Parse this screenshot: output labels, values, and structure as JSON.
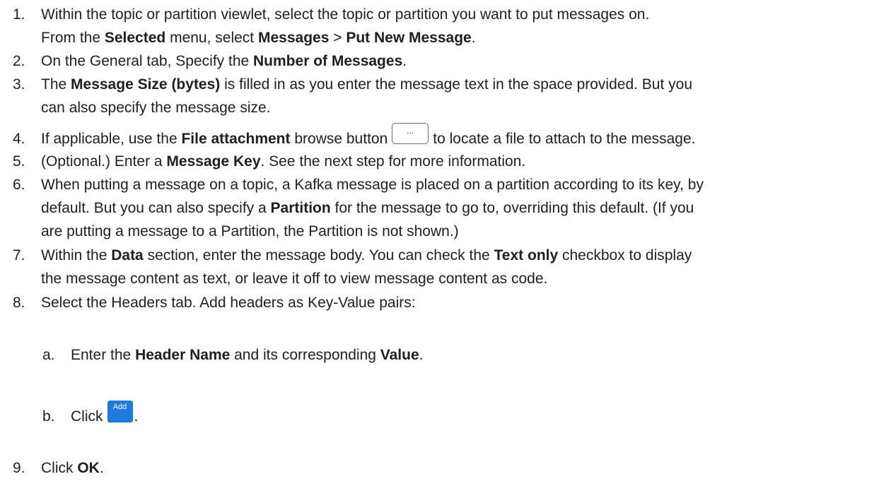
{
  "steps": [
    {
      "num": "1.",
      "lines": [
        [
          {
            "t": "Within the topic or partition viewlet, select the topic or partition you want to put messages on."
          }
        ],
        [
          {
            "t": "From the "
          },
          {
            "t": "Selected",
            "b": true
          },
          {
            "t": " menu, select "
          },
          {
            "t": "Messages",
            "b": true
          },
          {
            "t": " > "
          },
          {
            "t": "Put New Message",
            "b": true
          },
          {
            "t": "."
          }
        ]
      ]
    },
    {
      "num": "2.",
      "lines": [
        [
          {
            "t": "On the General tab, Specify the "
          },
          {
            "t": "Number of Messages",
            "b": true
          },
          {
            "t": "."
          }
        ]
      ]
    },
    {
      "num": "3.",
      "lines": [
        [
          {
            "t": "The "
          },
          {
            "t": "Message Size (bytes)",
            "b": true
          },
          {
            "t": " is filled in as you enter the message text in the space provided. But you"
          }
        ],
        [
          {
            "t": "can also specify the message size."
          }
        ]
      ]
    },
    {
      "num": "4.",
      "lines": [
        [
          {
            "t": "If applicable, use the "
          },
          {
            "t": "File attachment",
            "b": true
          },
          {
            "t": " browse button"
          },
          {
            "icon": "browse"
          },
          {
            "t": "to locate a file to attach to the message."
          }
        ]
      ]
    },
    {
      "num": "5.",
      "lines": [
        [
          {
            "t": "(Optional.) Enter a "
          },
          {
            "t": "Message Key",
            "b": true
          },
          {
            "t": ". See the next step for more information."
          }
        ]
      ]
    },
    {
      "num": "6.",
      "lines": [
        [
          {
            "t": "When putting a message on a topic, a Kafka message is placed on a partition according to its key, by"
          }
        ],
        [
          {
            "t": "default. But you can also specify a "
          },
          {
            "t": "Partition",
            "b": true
          },
          {
            "t": " for the message to go to, overriding this default. (If you"
          }
        ],
        [
          {
            "t": "are putting a message to a Partition, the Partition is not shown.)"
          }
        ]
      ]
    },
    {
      "num": "7.",
      "lines": [
        [
          {
            "t": "Within the "
          },
          {
            "t": "Data",
            "b": true
          },
          {
            "t": " section, enter the message body. You can check the "
          },
          {
            "t": "Text only",
            "b": true
          },
          {
            "t": " checkbox to display"
          }
        ],
        [
          {
            "t": "the message content as text, or leave it off to view message content as code."
          }
        ]
      ]
    },
    {
      "num": "8.",
      "lines": [
        [
          {
            "t": "Select the Headers tab. Add headers as Key-Value pairs:"
          }
        ]
      ]
    },
    {
      "num": "a.",
      "sub": true,
      "lines": [
        [
          {
            "t": "Enter the "
          },
          {
            "t": "Header Name",
            "b": true
          },
          {
            "t": " and its corresponding "
          },
          {
            "t": "Value",
            "b": true
          },
          {
            "t": "."
          }
        ]
      ]
    },
    {
      "num": "b.",
      "sub": true,
      "lines": [
        [
          {
            "t": "Click"
          },
          {
            "icon": "add"
          },
          {
            "t": "."
          }
        ]
      ]
    },
    {
      "num": "9.",
      "lines": [
        [
          {
            "t": "Click "
          },
          {
            "t": "OK",
            "b": true
          },
          {
            "t": "."
          }
        ]
      ]
    }
  ],
  "browse_button": {
    "label": "..."
  },
  "add_button": {
    "label": "Add",
    "color": "#1f7ae0"
  }
}
